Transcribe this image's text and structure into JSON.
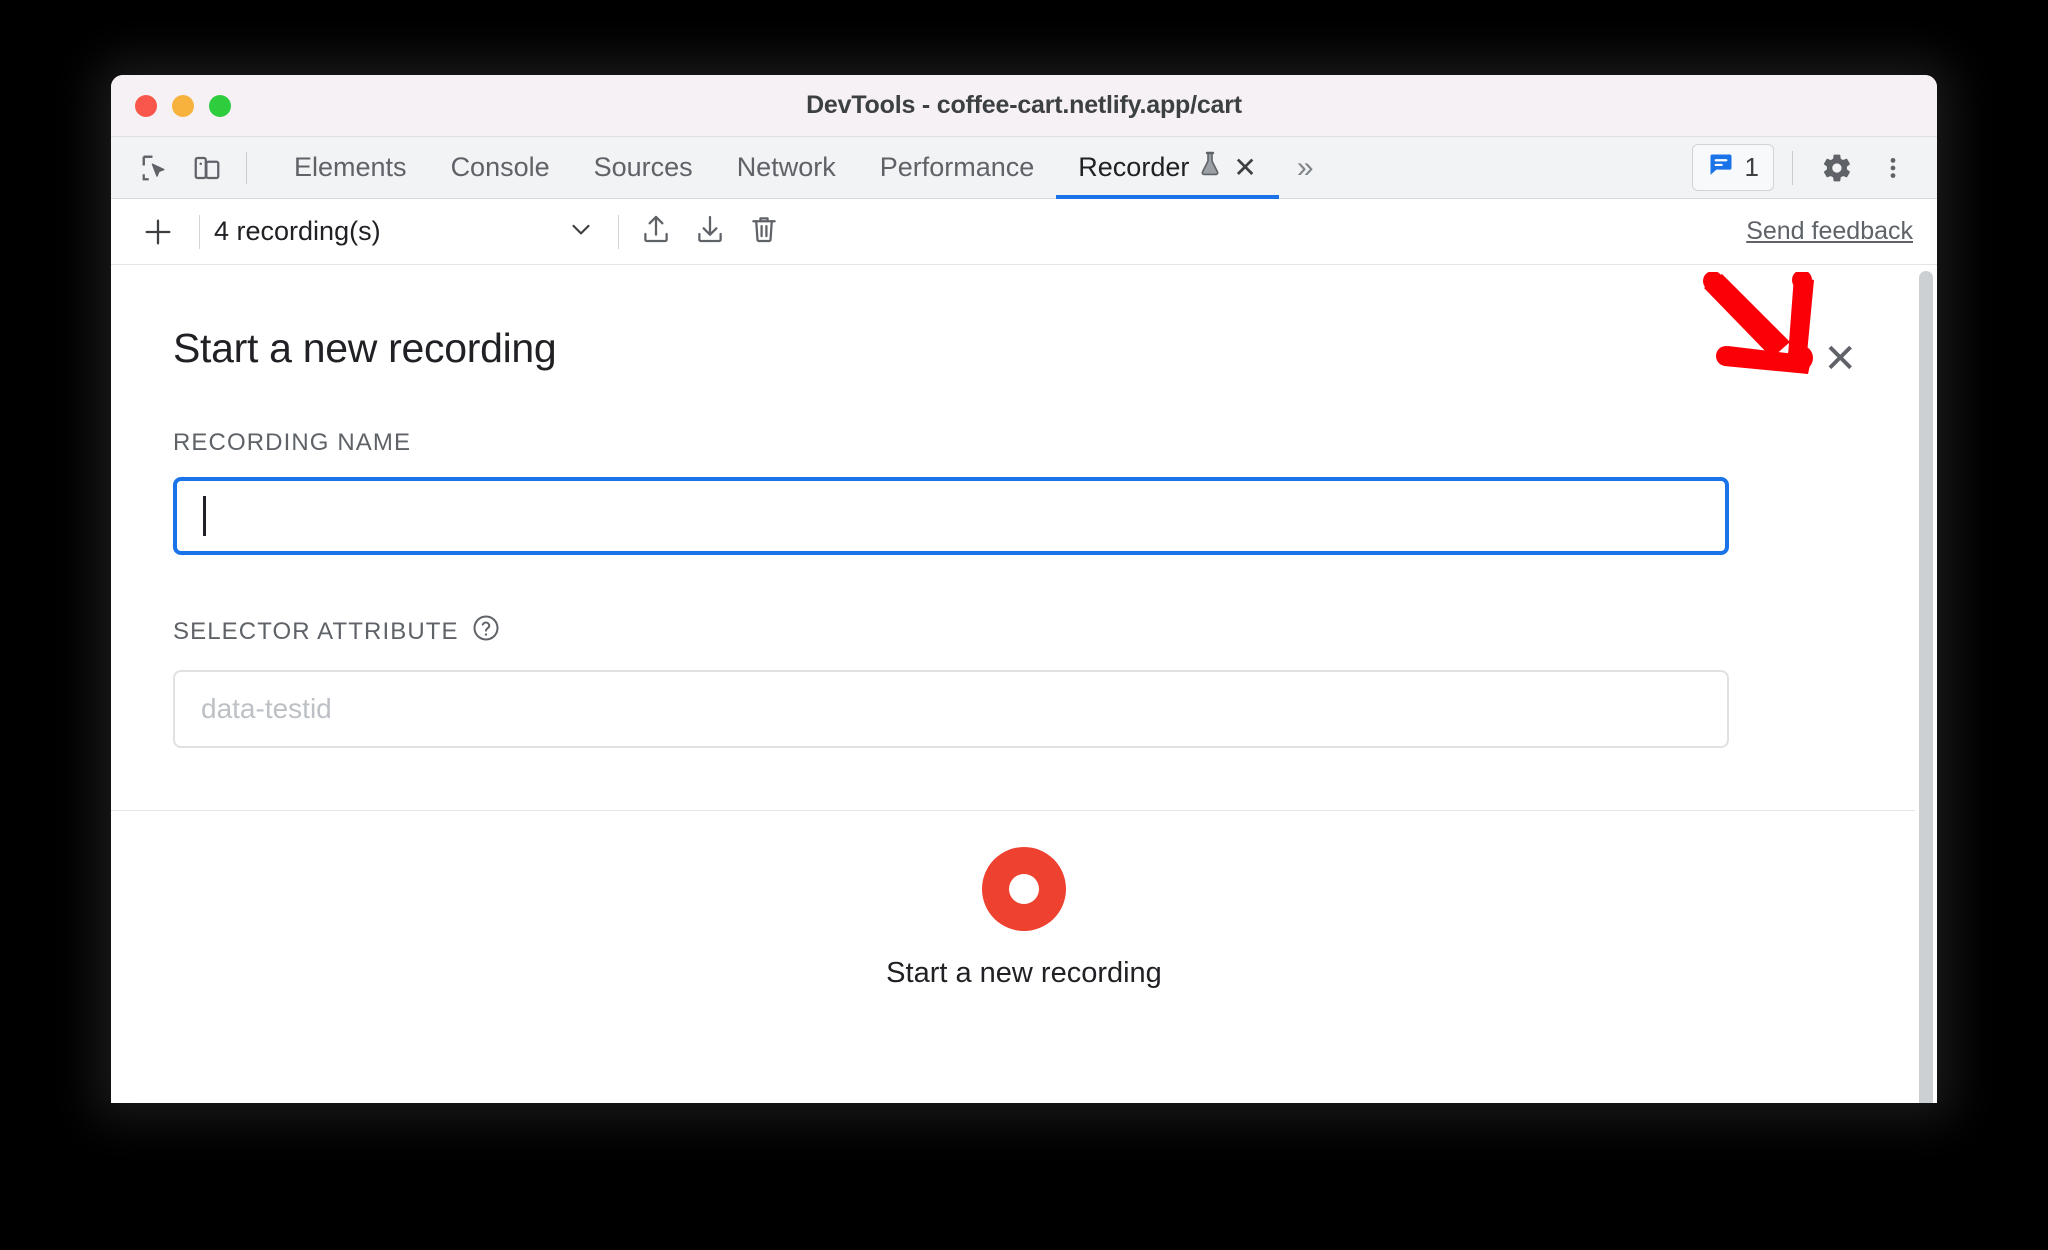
{
  "window": {
    "title": "DevTools - coffee-cart.netlify.app/cart",
    "traffic_lights": [
      "close",
      "minimize",
      "zoom"
    ]
  },
  "tabbar": {
    "inspect_icon": "inspect-cursor-icon",
    "device_icon": "device-toolbar-icon",
    "tabs": [
      {
        "label": "Elements",
        "active": false
      },
      {
        "label": "Console",
        "active": false
      },
      {
        "label": "Sources",
        "active": false
      },
      {
        "label": "Network",
        "active": false
      },
      {
        "label": "Performance",
        "active": false
      },
      {
        "label": "Recorder",
        "active": true,
        "experimental": true,
        "closable": true
      }
    ],
    "overflow_label": "»",
    "tab_close_label": "✕",
    "issues": {
      "icon": "issues-message-icon",
      "count": "1",
      "color": "#1a73e8"
    },
    "settings_icon": "gear-icon",
    "more_icon": "kebab-menu-icon"
  },
  "recorder_toolbar": {
    "add_label": "+",
    "recordings_select": "4 recording(s)",
    "chevron": "⌄",
    "import_icon": "import-upload-icon",
    "export_icon": "export-download-icon",
    "delete_icon": "trash-icon",
    "feedback_label": "Send feedback"
  },
  "panel": {
    "title": "Start a new recording",
    "close_label": "✕",
    "fields": [
      {
        "label": "RECORDING NAME",
        "value": "",
        "placeholder": "",
        "focused": true,
        "help": false
      },
      {
        "label": "SELECTOR ATTRIBUTE",
        "value": "",
        "placeholder": "data-testid",
        "focused": false,
        "help": true,
        "help_icon": "help-question-icon"
      }
    ],
    "record_button": {
      "icon": "record-circle-icon",
      "label": "Start a new recording",
      "color": "#ef4130"
    }
  },
  "annotation": {
    "arrow": "red-pointer-arrow",
    "color": "#ff0000",
    "points_at": "panel-close-button"
  },
  "colors": {
    "accent_blue": "#1a73e8",
    "record_red": "#ef4130",
    "annotation_red": "#ff0000",
    "titlebar_bg": "#f6f1f4",
    "tabbar_bg": "#f1f3f4"
  }
}
